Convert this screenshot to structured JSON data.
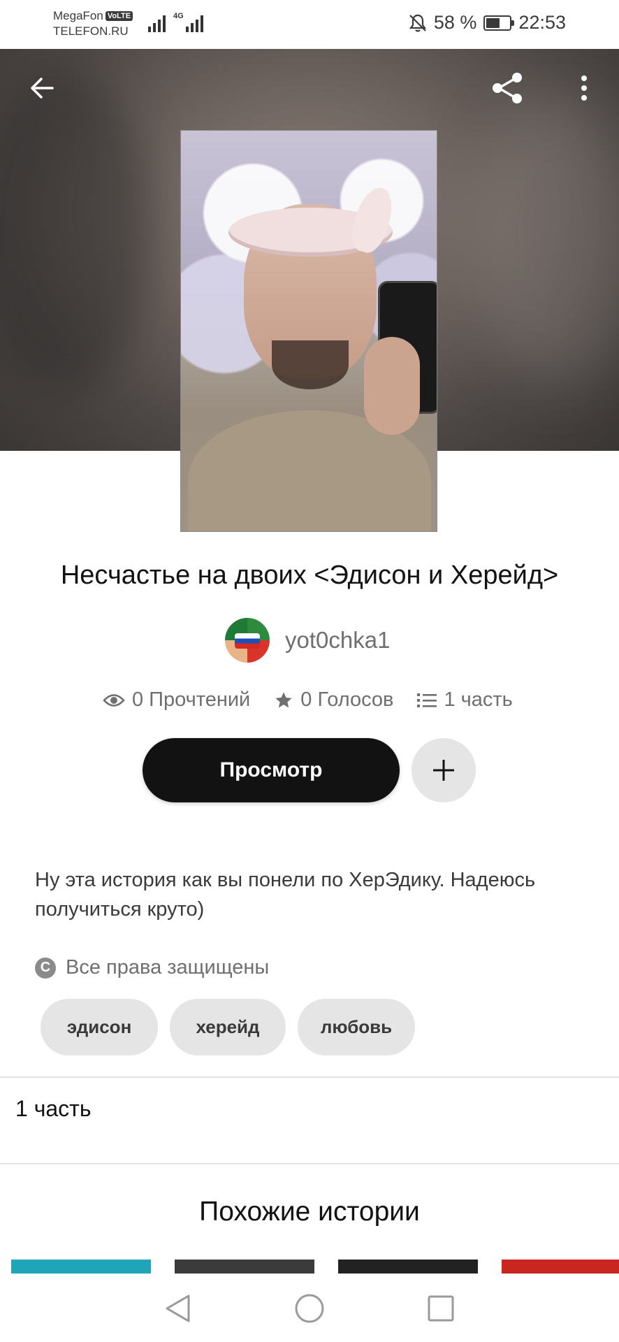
{
  "status_bar": {
    "carrier_name": "MegaFon",
    "volte_label": "VoLTE",
    "carrier_sub": "TELEFON.RU",
    "network_label": "4G",
    "battery_text": "58 %",
    "battery_level": 0.58,
    "time": "22:53"
  },
  "header": {
    "back_icon": "arrow-left-icon",
    "share_icon": "share-icon",
    "more_icon": "more-vertical-icon"
  },
  "story": {
    "title": "Несчастье на двоих <Эдисон и Херейд>",
    "author": "yot0chka1",
    "stats": {
      "reads": "0 Прочтений",
      "votes": "0 Голосов",
      "parts": "1 часть"
    },
    "read_button": "Просмотр",
    "description": "Ну эта история как вы понели по ХерЭдику. Надеюсь получиться круто)",
    "rights": "Все права защищены",
    "tags": [
      "эдисон",
      "херейд",
      "любовь"
    ],
    "parts_count_label": "1 часть"
  },
  "similar": {
    "heading": "Похожие истории",
    "thumb_colors": [
      "#1fa4b8",
      "#3b3b3b",
      "#222222",
      "#c8261e"
    ]
  },
  "colors": {
    "primary_button": "#121212",
    "secondary_button": "#e6e5e6",
    "muted_text": "#6f6f6f"
  }
}
